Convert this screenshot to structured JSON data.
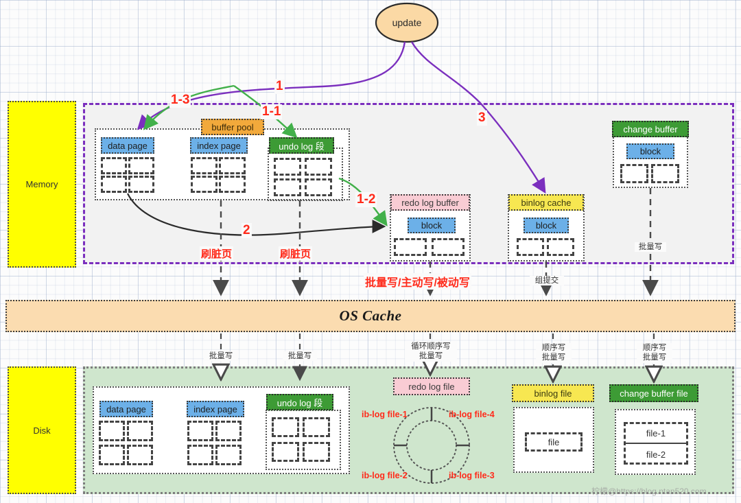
{
  "regions": {
    "memory_label": "Memory",
    "disk_label": "Disk",
    "os_cache_label": "OS Cache"
  },
  "start_node": {
    "label": "update"
  },
  "memory": {
    "buffer_pool": {
      "label": "buffer pool"
    },
    "items": [
      {
        "label": "data page",
        "style": "blue"
      },
      {
        "label": "index page",
        "style": "blue"
      },
      {
        "label": "undo log 段",
        "style": "green"
      }
    ],
    "redo_log_buffer": {
      "label": "redo log buffer",
      "block_label": "block"
    },
    "binlog_cache": {
      "label": "binlog  cache",
      "block_label": "block"
    },
    "change_buffer": {
      "label": "change buffer",
      "block_label": "block"
    }
  },
  "disk": {
    "items": [
      {
        "label": "data page",
        "style": "blue"
      },
      {
        "label": "index page",
        "style": "blue"
      },
      {
        "label": "undo log 段",
        "style": "green"
      }
    ],
    "redo_log_file": {
      "label": "redo log file",
      "segments": [
        "ib-log file-1",
        "ib-log file-4",
        "ib-log file-2",
        "ib-log file-3"
      ]
    },
    "binlog_file": {
      "label": "binlog file",
      "inner_label": "file"
    },
    "change_buffer_file": {
      "label": "change buffer file",
      "inner_labels": [
        "file-1",
        "file-2"
      ]
    }
  },
  "flow_numbers": {
    "n1": "1",
    "n1_1": "1-1",
    "n1_2": "1-2",
    "n1_3": "1-3",
    "n2": "2",
    "n3": "3"
  },
  "flow_labels": {
    "dirty_page_1": "刷脏页",
    "dirty_page_2": "刷脏页",
    "redo_write": "批量写/主动写/被动写",
    "group_commit": "组提交",
    "change_buffer_write": "批量写"
  },
  "disk_write_labels": {
    "data_page": "批量写",
    "index_page": "批量写",
    "redo_log": "循环顺序写\n批量写",
    "redo_log_line1": "循环顺序写",
    "redo_log_line2": "批量写",
    "binlog_line1": "顺序写",
    "binlog_line2": "批量写",
    "change_buffer_line1": "顺序写",
    "change_buffer_line2": "批量写"
  },
  "watermark": {
    "text": "柠檬@https://blog.ntan520.com"
  },
  "colors": {
    "blue": "#6cb0e8",
    "green": "#3d9b35",
    "orange": "#f2a93b",
    "pink": "#f9ccd4",
    "yellow": "#f7e751",
    "purple": "#7b2fbe",
    "red": "#ff2a1a",
    "arrow_green": "#42b04a",
    "os_cache": "#fbdcb0",
    "disk_bg": "#cfe6cd",
    "side_yellow": "#ffff00"
  }
}
